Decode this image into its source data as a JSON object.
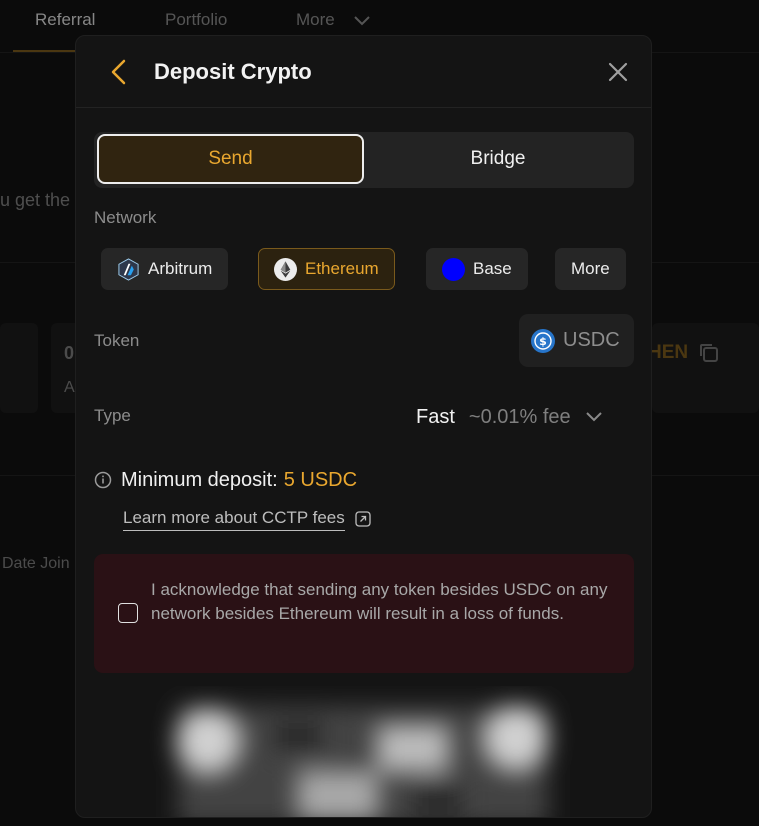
{
  "background": {
    "tabs": [
      {
        "label": "Referral",
        "active": true
      },
      {
        "label": "Portfolio",
        "active": false
      },
      {
        "label": "More",
        "active": false
      }
    ],
    "snippet": "u get the",
    "card_value_fragment": "0",
    "card_sub_fragment": "A",
    "gold_fragment": "HEN",
    "date_joined_label": "Date Join"
  },
  "modal": {
    "title": "Deposit Crypto",
    "segments": {
      "send": "Send",
      "bridge": "Bridge",
      "selected": "Send"
    },
    "network_label": "Network",
    "networks": [
      {
        "label": "Arbitrum",
        "icon": "arbitrum-icon",
        "selected": false
      },
      {
        "label": "Ethereum",
        "icon": "ethereum-icon",
        "selected": true
      },
      {
        "label": "Base",
        "icon": "base-icon",
        "selected": false
      },
      {
        "label": "More",
        "icon": "",
        "selected": false
      }
    ],
    "token_label": "Token",
    "token": {
      "symbol": "USDC",
      "icon": "usdc-icon"
    },
    "type_label": "Type",
    "type": {
      "speed": "Fast",
      "fee": "~0.01% fee"
    },
    "minimum": {
      "label": "Minimum deposit:",
      "value": "5 USDC"
    },
    "learn_more": "Learn more about CCTP fees",
    "acknowledgement": "I acknowledge that sending any token besides USDC on any network besides Ethereum will result in a loss of funds."
  },
  "colors": {
    "accent": "#e9a72f",
    "modal_bg": "#141414",
    "warning_bg": "#2a1115",
    "base_blue": "#0000ff",
    "usdc_blue": "#2775ca"
  }
}
